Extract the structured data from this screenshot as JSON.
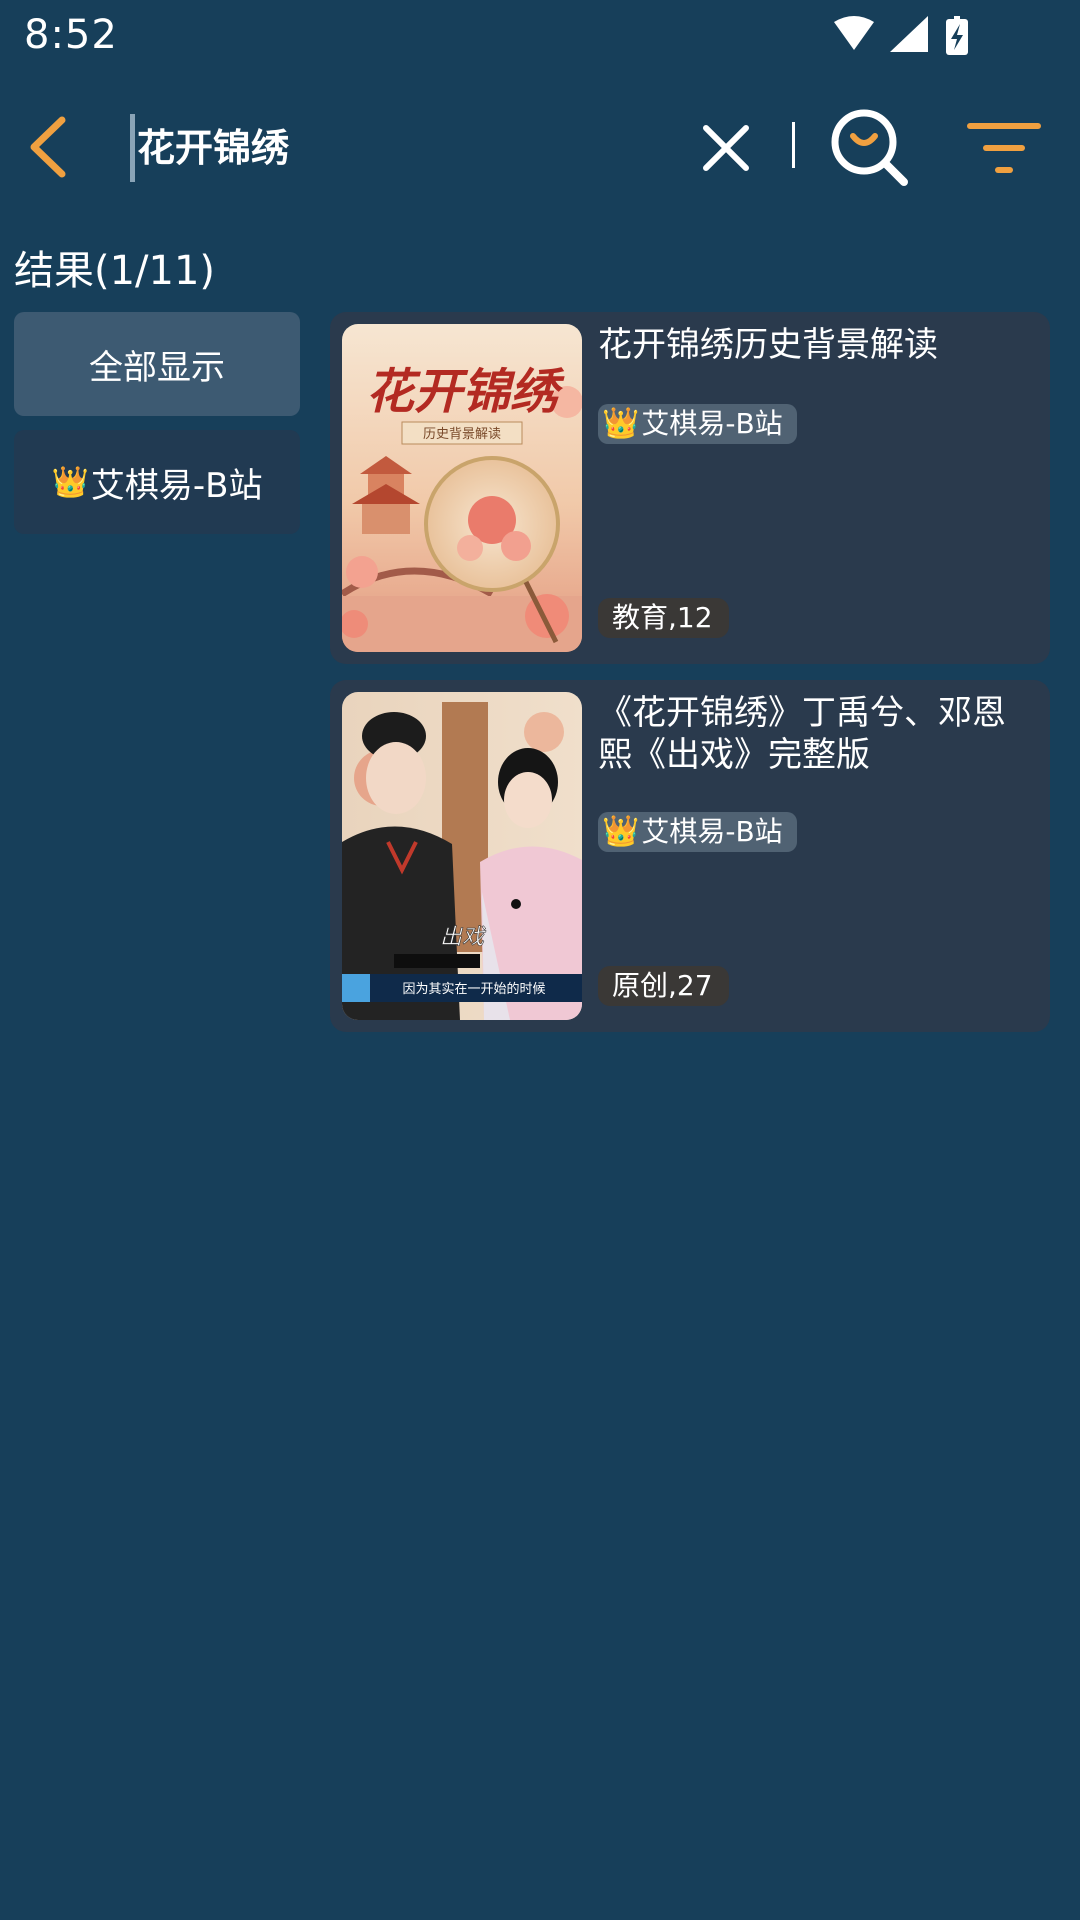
{
  "status_bar": {
    "time": "8:52",
    "icons": [
      "wifi-icon",
      "cell-signal-icon",
      "battery-charging-icon"
    ]
  },
  "search": {
    "query": "花开锦绣",
    "icons": {
      "back": "chevron-left-icon",
      "clear": "close-icon",
      "search": "search-icon",
      "filter": "filter-icon"
    },
    "accent_color": "#f0a040"
  },
  "results_header": "结果(1/11)",
  "filters": [
    {
      "label": "全部显示",
      "selected": true
    },
    {
      "crown": "👑",
      "label": "艾棋易-B站",
      "selected": false
    }
  ],
  "results": [
    {
      "title": "花开锦绣历史背景解读",
      "crown": "👑",
      "source": "艾棋易-B站",
      "category": "教育,12",
      "thumbnail": {
        "title_text": "花开锦绣",
        "subtitle_text": "历史背景解读"
      }
    },
    {
      "title": "《花开锦绣》丁禹兮、邓恩熙《出戏》完整版",
      "crown": "👑",
      "source": "艾棋易-B站",
      "category": "原创,27",
      "thumbnail": {
        "overlay_text": "出戏",
        "caption_text": "因为其实在一开始的时候"
      }
    }
  ],
  "colors": {
    "background": "#173f5a",
    "card": "#2a3a4d",
    "selected_chip": "#3d5a72",
    "unselected_chip": "#213a52",
    "crown": "#f2b43a"
  }
}
